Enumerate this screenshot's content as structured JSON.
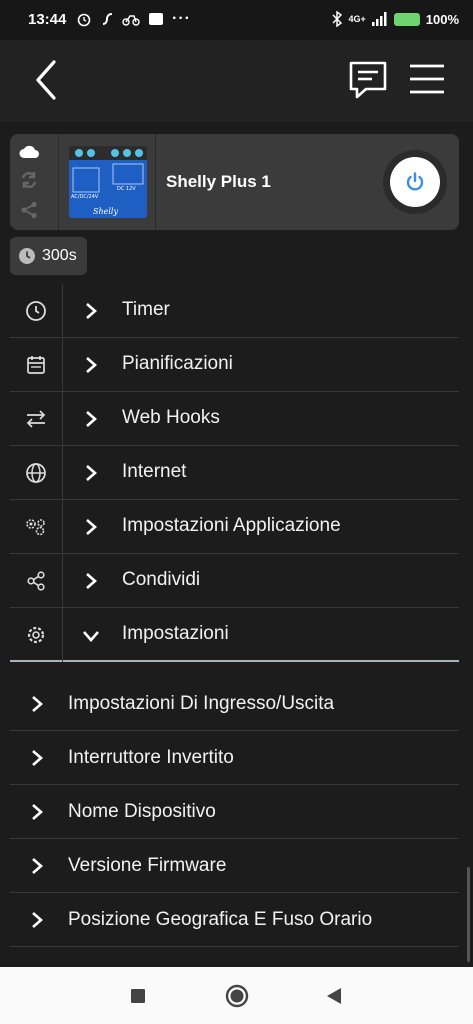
{
  "status_bar": {
    "time": "13:44",
    "network": "4G+",
    "battery": "100%"
  },
  "device": {
    "name": "Shelly Plus 1",
    "image_labels": [
      "AC/DC/24V",
      "DC 12V",
      "Shelly"
    ]
  },
  "timer_badge": "300s",
  "menu": [
    {
      "icon": "clock-icon",
      "label": "Timer",
      "expanded": false
    },
    {
      "icon": "calendar-icon",
      "label": "Pianificazioni",
      "expanded": false
    },
    {
      "icon": "arrows-icon",
      "label": "Web Hooks",
      "expanded": false
    },
    {
      "icon": "globe-icon",
      "label": "Internet",
      "expanded": false
    },
    {
      "icon": "app-settings-icon",
      "label": "Impostazioni Applicazione",
      "expanded": false
    },
    {
      "icon": "share-icon",
      "label": "Condividi",
      "expanded": false
    },
    {
      "icon": "gear-icon",
      "label": "Impostazioni",
      "expanded": true
    }
  ],
  "submenu": [
    {
      "label": "Impostazioni Di Ingresso/Uscita"
    },
    {
      "label": "Interruttore Invertito"
    },
    {
      "label": "Nome Dispositivo"
    },
    {
      "label": "Versione Firmware"
    },
    {
      "label": "Posizione Geografica E Fuso Orario"
    }
  ],
  "colors": {
    "power_icon": "#3a8ee6",
    "background": "#1c1c1c",
    "card": "#3b3b3b"
  }
}
